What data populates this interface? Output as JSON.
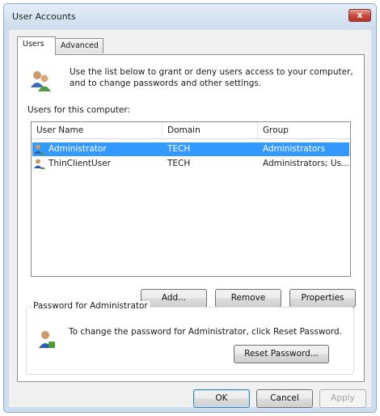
{
  "window": {
    "title": "User Accounts",
    "close_glyph": "x"
  },
  "tabs": [
    {
      "label": "Users",
      "active": true
    },
    {
      "label": "Advanced",
      "active": false
    }
  ],
  "intro": {
    "icon": "users-group-icon",
    "text": "Use the list below to grant or deny users access to your computer, and to change passwords and other settings."
  },
  "users_section": {
    "label": "Users for this computer:",
    "columns": [
      "User Name",
      "Domain",
      "Group"
    ],
    "rows": [
      {
        "user": "Administrator",
        "domain": "TECH",
        "group": "Administrators",
        "selected": true
      },
      {
        "user": "ThinClientUser",
        "domain": "TECH",
        "group": "Administrators; Us...",
        "selected": false
      }
    ]
  },
  "list_buttons": {
    "add": "Add...",
    "remove": "Remove",
    "properties": "Properties"
  },
  "password_group": {
    "title": "Password for Administrator",
    "text": "To change the password for Administrator, click Reset Password.",
    "reset_button": "Reset Password..."
  },
  "dialog_buttons": {
    "ok": "OK",
    "cancel": "Cancel",
    "apply": "Apply",
    "apply_enabled": false
  },
  "colors": {
    "selection": "#3399ff",
    "close_button": "#c8463a",
    "frame": "#cddcee"
  }
}
